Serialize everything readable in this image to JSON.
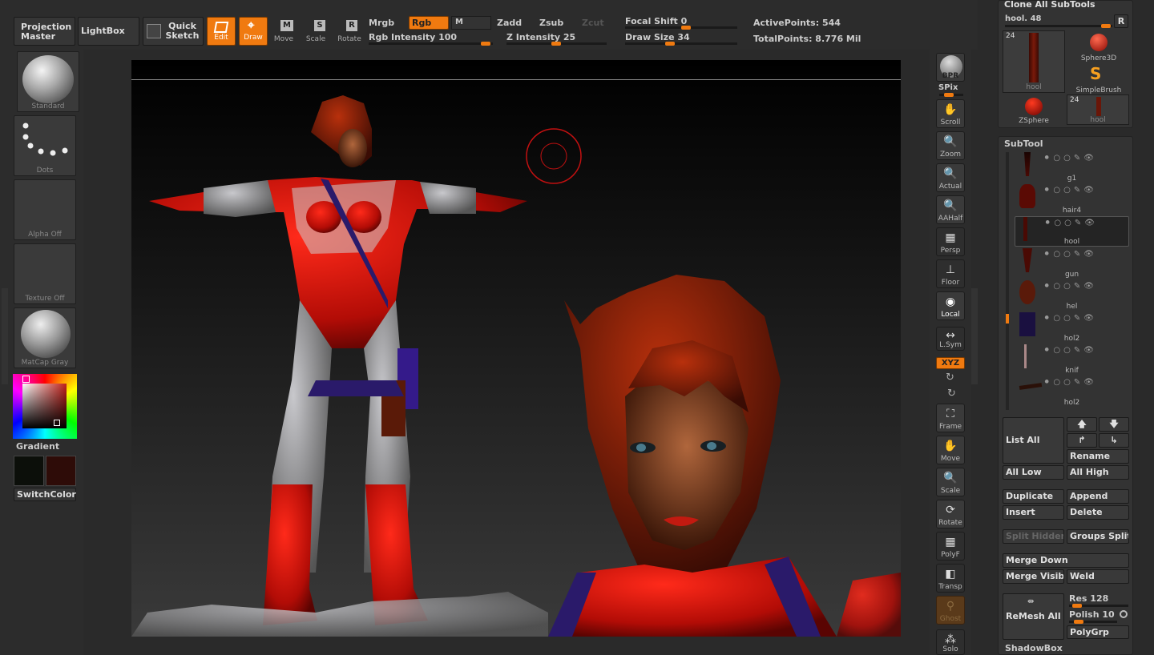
{
  "toolbar": {
    "projection_master": "Projection Master",
    "lightbox": "LightBox",
    "quick_sketch": "Quick Sketch",
    "edit": "Edit",
    "draw": "Draw",
    "move": "Move",
    "scale": "Scale",
    "rotate": "Rotate",
    "mrgb": "Mrgb",
    "rgb": "Rgb",
    "m": "M",
    "zadd": "Zadd",
    "zsub": "Zsub",
    "zcut": "Zcut",
    "rgb_intensity": "Rgb Intensity 100",
    "z_intensity": "Z Intensity 25",
    "focal_shift": "Focal Shift 0",
    "draw_size": "Draw Size 34",
    "active_points": "ActivePoints: 544",
    "total_points": "TotalPoints: 8.776 Mil",
    "move_key": "M",
    "scale_key": "S",
    "rotate_key": "R"
  },
  "left_shelf": {
    "standard": "Standard",
    "dots": "Dots",
    "alpha": "Alpha Off",
    "texture": "Texture Off",
    "matcap": "MatCap Gray",
    "gradient": "Gradient",
    "switchcolor": "SwitchColor",
    "main_color": "#0c0f0a",
    "secondary_color": "#2e0c08"
  },
  "right_shelf": {
    "bpr": "BPR",
    "spix": "SPix",
    "scroll": "Scroll",
    "zoom": "Zoom",
    "actual": "Actual",
    "aahalf": "AAHalf",
    "persp": "Persp",
    "floor": "Floor",
    "local": "Local",
    "lsym": "L.Sym",
    "xyz": "XYZ",
    "frame": "Frame",
    "move": "Move",
    "scale": "Scale",
    "rotate": "Rotate",
    "polyf": "PolyF",
    "transp": "Transp",
    "ghost": "Ghost",
    "solo": "Solo"
  },
  "tool_panel": {
    "clone_all": "Clone All SubTools",
    "current_tool": "hool. 48",
    "r_button": "R",
    "tools": [
      {
        "name": "hool",
        "count": "24"
      },
      {
        "name": "Sphere3D",
        "count": ""
      },
      {
        "name": "SimpleBrush",
        "count": ""
      },
      {
        "name": "ZSphere",
        "count": ""
      },
      {
        "name": "hool",
        "count": "24"
      }
    ]
  },
  "subtool": {
    "title": "SubTool",
    "items": [
      "g1",
      "hair4",
      "hool",
      "gun",
      "hel",
      "hol2",
      "knif",
      "hol2"
    ],
    "list_all": "List All",
    "rename": "Rename",
    "all_low": "All Low",
    "all_high": "All High",
    "duplicate": "Duplicate",
    "append": "Append",
    "insert": "Insert",
    "delete": "Delete",
    "split_hidden": "Split Hidden",
    "groups_split": "Groups Split",
    "merge_down": "Merge Down",
    "merge_visible": "Merge Visible",
    "weld": "Weld",
    "remesh_all": "ReMesh All",
    "res": "Res 128",
    "polish": "Polish 10",
    "polygrp": "PolyGrp",
    "shadowbox": "ShadowBox"
  }
}
